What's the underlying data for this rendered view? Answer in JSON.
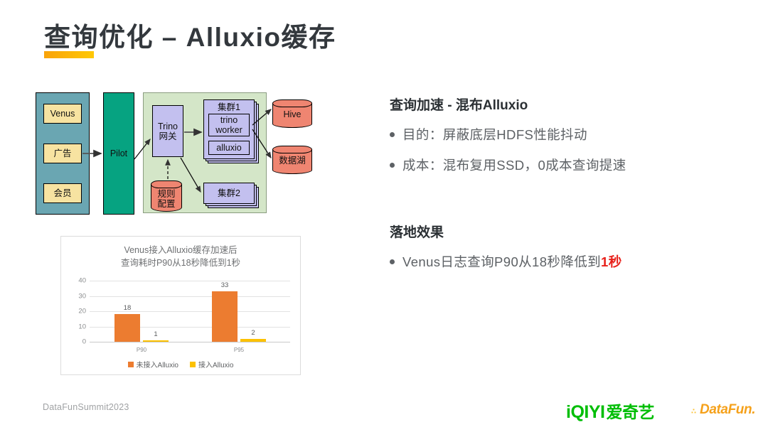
{
  "slide": {
    "title": "查询优化 – Alluxio缓存",
    "accent_color": "#ffc805",
    "footer_left": "DataFunSummit2023"
  },
  "diagram": {
    "sources": [
      "Venus",
      "广告",
      "会员"
    ],
    "gateway_service": "Pilot",
    "trino_gateway": "Trino\n网关",
    "trino_gateway_line1": "Trino",
    "trino_gateway_line2": "网关",
    "rule_config_line1": "规则",
    "rule_config_line2": "配置",
    "cluster1": "集群1",
    "cluster1_worker_line1": "trino",
    "cluster1_worker_line2": "worker",
    "cluster1_alluxio": "alluxio",
    "cluster2": "集群2",
    "storage": [
      "Hive",
      "数据湖"
    ],
    "colors": {
      "source_column": "#6aa6b2",
      "source_box": "#f7e3a1",
      "pilot": "#06a381",
      "panel": "#d4e6c8",
      "node": "#c3c0ef",
      "storage": "#ef8571"
    }
  },
  "chart_data": {
    "type": "bar",
    "title": "Venus接入Alluxio缓存加速后\n查询耗时P90从18秒降低到1秒",
    "title_line1": "Venus接入Alluxio缓存加速后",
    "title_line2": "查询耗时P90从18秒降低到1秒",
    "categories": [
      "P90",
      "P95"
    ],
    "series": [
      {
        "name": "未接入Alluxio",
        "values": [
          18,
          33
        ],
        "color": "#ec7c30"
      },
      {
        "name": "接入Alluxio",
        "values": [
          1,
          2
        ],
        "color": "#fcc101"
      }
    ],
    "yticks": [
      40,
      30,
      20,
      10,
      0
    ],
    "ylim": [
      0,
      40
    ],
    "xlabel": "",
    "ylabel": "",
    "grid": true,
    "legend_position": "bottom"
  },
  "right": {
    "section1": {
      "heading": "查询加速 - 混布Alluxio",
      "bullets": [
        "目的：屏蔽底层HDFS性能抖动",
        "成本：混布复用SSD，0成本查询提速"
      ]
    },
    "section2": {
      "heading": "落地效果",
      "bullet_prefix": "Venus日志查询P90从18秒降低到",
      "bullet_highlight": "1秒",
      "highlight_color": "#e8211b"
    }
  },
  "logos": {
    "iqiyi_latin": "iQIYI",
    "iqiyi_cn": "爱奇艺",
    "iqiyi_color": "#00be06",
    "datafun": "DataFun.",
    "datafun_color": "#f5a11b"
  }
}
